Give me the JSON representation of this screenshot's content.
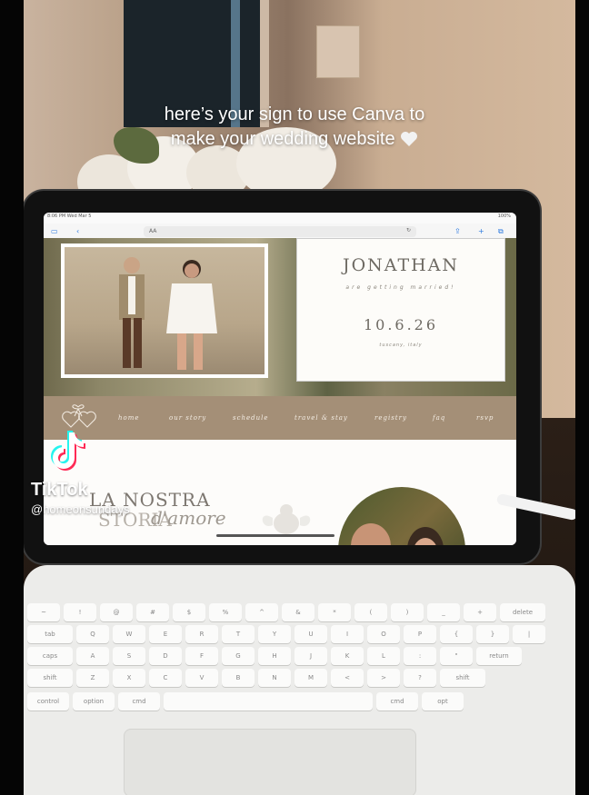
{
  "caption": {
    "line1": "here’s your sign to use Canva to",
    "line2": "make your wedding website"
  },
  "ipad": {
    "status_time": "8:06 PM  Wed Mar 5",
    "status_right": "100%",
    "url_text": "AA",
    "hero_card": {
      "name": "JONATHAN",
      "subtitle": "are getting married!",
      "date": "10.6.26",
      "location": "tuscany, italy"
    },
    "nav_items": [
      "home",
      "our story",
      "schedule",
      "travel & stay",
      "registry",
      "faq",
      "rsvp"
    ],
    "story": {
      "line1": "LA NOSTRA",
      "line2": "STORIA",
      "script": "d'amore"
    }
  },
  "keyboard": {
    "row1": [
      "~",
      "!",
      "@",
      "#",
      "$",
      "%",
      "^",
      "&",
      "*",
      "(",
      ")",
      "_",
      "+",
      "delete"
    ],
    "row2": [
      "tab",
      "Q",
      "W",
      "E",
      "R",
      "T",
      "Y",
      "U",
      "I",
      "O",
      "P",
      "{",
      "}",
      "|"
    ],
    "row3": [
      "caps",
      "A",
      "S",
      "D",
      "F",
      "G",
      "H",
      "J",
      "K",
      "L",
      ":",
      "\"",
      "return"
    ],
    "row4": [
      "shift",
      "Z",
      "X",
      "C",
      "V",
      "B",
      "N",
      "M",
      "<",
      ">",
      "?",
      "shift"
    ],
    "row5": [
      "control",
      "option",
      "cmd",
      "",
      "cmd",
      "opt"
    ]
  },
  "watermark": {
    "brand": "TikTok",
    "user": "@homeonsundays"
  },
  "colors": {
    "nav_bg": "#a48f77",
    "card_text": "#6e6a63",
    "caption": "#ffffff"
  }
}
